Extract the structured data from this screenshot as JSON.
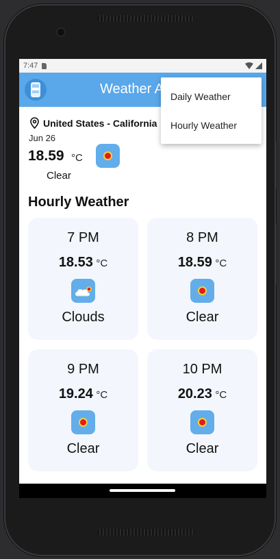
{
  "status_bar": {
    "time": "7:47"
  },
  "app_bar": {
    "title": "Weather A"
  },
  "location": {
    "name": "United States - California"
  },
  "current": {
    "date": "Jun 26",
    "temp": "18.59",
    "unit": "°C",
    "condition": "Clear",
    "icon": "sun-icon"
  },
  "section_title": "Hourly Weather",
  "hourly": [
    {
      "hour": "7 PM",
      "temp": "18.53",
      "unit": "°C",
      "condition": "Clouds",
      "icon": "cloud-icon"
    },
    {
      "hour": "8 PM",
      "temp": "18.59",
      "unit": "°C",
      "condition": "Clear",
      "icon": "sun-icon"
    },
    {
      "hour": "9 PM",
      "temp": "19.24",
      "unit": "°C",
      "condition": "Clear",
      "icon": "sun-icon"
    },
    {
      "hour": "10 PM",
      "temp": "20.23",
      "unit": "°C",
      "condition": "Clear",
      "icon": "sun-icon"
    }
  ],
  "menu": {
    "items": [
      "Daily Weather",
      "Hourly Weather"
    ]
  },
  "colors": {
    "app_bar": "#5aa7ea",
    "icon_tile": "#63adea",
    "card_bg": "#f3f6fc"
  }
}
